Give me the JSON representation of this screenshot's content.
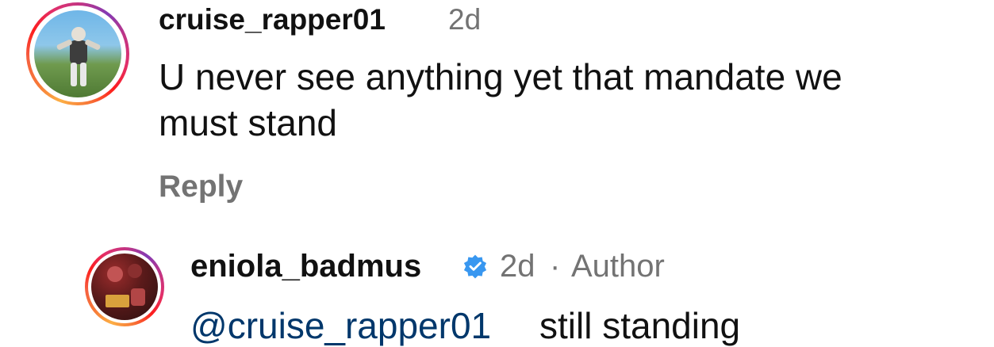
{
  "comments": [
    {
      "username": "cruise_rapper01",
      "time": "2d",
      "text_line1": "U never see anything yet that mandate we",
      "text_line2": "must stand",
      "reply_label": "Reply"
    },
    {
      "username": "eniola_badmus",
      "verified": true,
      "time": "2d",
      "separator": "·",
      "author_badge": "Author",
      "mention": "@cruise_rapper01",
      "text": "still standing"
    }
  ],
  "icons": {
    "verified": "verified-badge-icon"
  },
  "colors": {
    "text": "#111111",
    "meta": "#737373",
    "mention": "#00376b",
    "verified": "#3897f0"
  }
}
